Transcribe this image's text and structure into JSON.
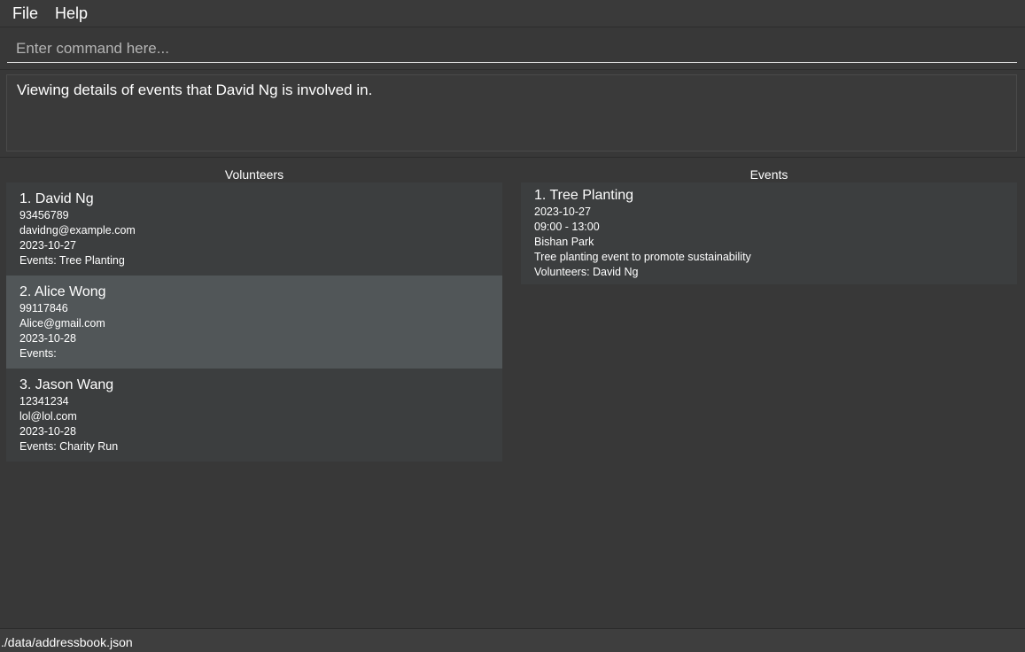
{
  "menu": {
    "file_label": "File",
    "help_label": "Help"
  },
  "command": {
    "value": "",
    "placeholder": "Enter command here..."
  },
  "result": {
    "text": "Viewing details of events that David Ng is involved in."
  },
  "volunteers": {
    "title": "Volunteers",
    "items": [
      {
        "name": "1. David Ng",
        "phone": "93456789",
        "email": "davidng@example.com",
        "date": "2023-10-27",
        "events": "Events: Tree Planting",
        "selected": false
      },
      {
        "name": "2. Alice Wong",
        "phone": "99117846",
        "email": "Alice@gmail.com",
        "date": "2023-10-28",
        "events": "Events:",
        "selected": true
      },
      {
        "name": "3. Jason Wang",
        "phone": "12341234",
        "email": "lol@lol.com",
        "date": "2023-10-28",
        "events": "Events: Charity Run",
        "selected": false
      }
    ]
  },
  "events": {
    "title": "Events",
    "items": [
      {
        "name": "1. Tree Planting",
        "date": "2023-10-27",
        "time": "09:00 - 13:00",
        "location": "Bishan Park",
        "description": "Tree planting event to promote sustainability",
        "volunteers": "Volunteers: David Ng"
      }
    ]
  },
  "status": {
    "path": "./data/addressbook.json"
  }
}
